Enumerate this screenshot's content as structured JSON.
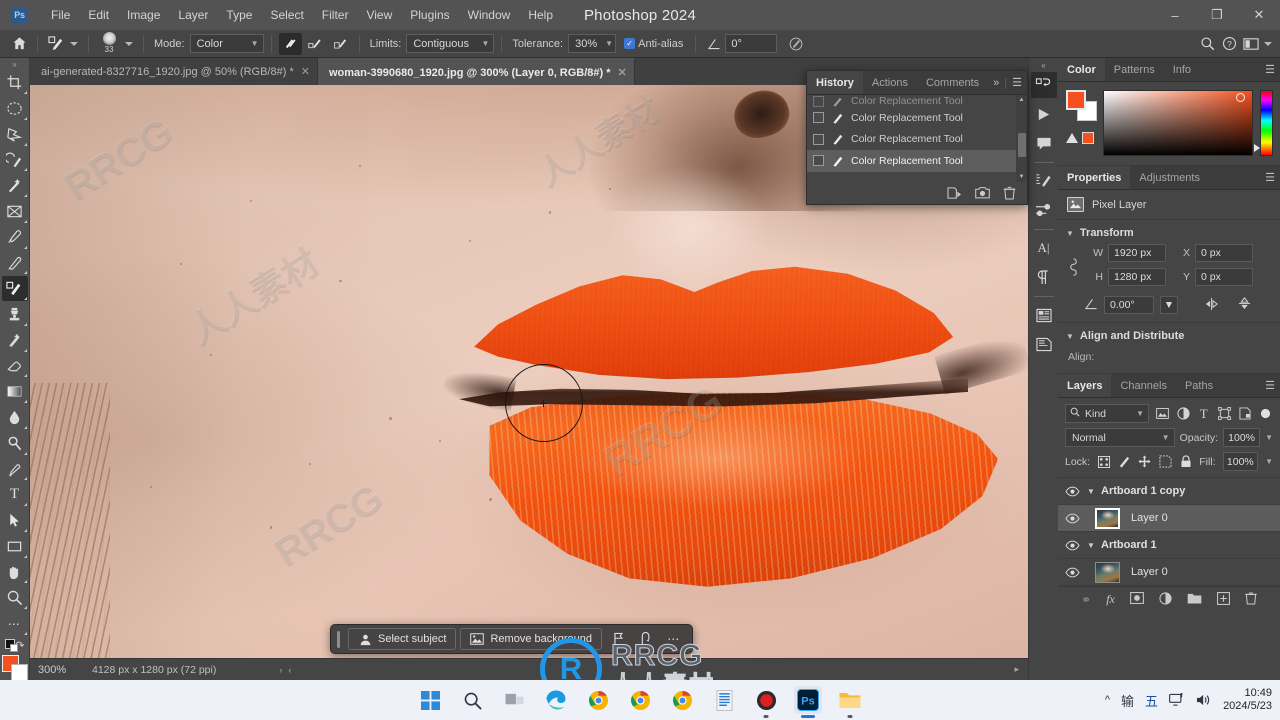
{
  "window": {
    "title": "Photoshop 2024",
    "app_logo": "ps-logo",
    "minimize": "–",
    "maximize": "❐",
    "close": "✕"
  },
  "menubar": {
    "items": [
      {
        "label": "File"
      },
      {
        "label": "Edit"
      },
      {
        "label": "Image"
      },
      {
        "label": "Layer"
      },
      {
        "label": "Type"
      },
      {
        "label": "Select"
      },
      {
        "label": "Filter"
      },
      {
        "label": "View"
      },
      {
        "label": "Plugins"
      },
      {
        "label": "Window"
      },
      {
        "label": "Help"
      }
    ]
  },
  "options_bar": {
    "home_icon": "home-icon",
    "tool_preset_icon": "color-replacement-tool-icon",
    "brush_size": "33",
    "mode_label": "Mode:",
    "mode_value": "Color",
    "sampling_continuous_icon": "sampling-continuous-icon",
    "sampling_once_icon": "sampling-once-icon",
    "sampling_background_icon": "sampling-background-swatch-icon",
    "limits_label": "Limits:",
    "limits_value": "Contiguous",
    "tolerance_label": "Tolerance:",
    "tolerance_value": "30%",
    "antialias_label": "Anti-alias",
    "antialias_checked": true,
    "angle_label": "angle-icon",
    "angle_value": "0°",
    "pressure_icon": "tablet-pressure-icon",
    "search_icon": "search-icon",
    "help_icon": "help-icon",
    "workspace_icon": "workspace-switcher-icon"
  },
  "toolbar": {
    "collapse_icon": "expand-toolbar-icon",
    "tools": [
      {
        "name": "crop-tool",
        "glyph": "⯨",
        "active": false
      },
      {
        "name": "elliptical-marquee-tool",
        "glyph": "◯",
        "active": false
      },
      {
        "name": "lasso-tool",
        "glyph": "⬠",
        "active": false
      },
      {
        "name": "object-selection-tool",
        "glyph": "⥁",
        "active": false
      },
      {
        "name": "quick-selection-tool",
        "glyph": "✒",
        "active": false
      },
      {
        "name": "frame-tool",
        "glyph": "⌧",
        "active": false
      },
      {
        "name": "eyedropper-tool",
        "glyph": "✐",
        "active": false
      },
      {
        "name": "healing-brush-tool",
        "glyph": "✎",
        "active": false
      },
      {
        "name": "color-replacement-tool",
        "glyph": "὘C",
        "active": true
      },
      {
        "name": "clone-stamp-tool",
        "glyph": "⚍",
        "active": false
      },
      {
        "name": "history-brush-tool",
        "glyph": "✐",
        "active": false
      },
      {
        "name": "eraser-tool",
        "glyph": "▱",
        "active": false
      },
      {
        "name": "gradient-tool",
        "glyph": "▤",
        "active": false
      },
      {
        "name": "blur-tool",
        "glyph": "Ὂ7",
        "active": false
      },
      {
        "name": "dodge-tool",
        "glyph": "⚲",
        "active": false
      },
      {
        "name": "pen-tool",
        "glyph": "✒",
        "active": false
      },
      {
        "name": "type-tool",
        "glyph": "T",
        "active": false
      },
      {
        "name": "path-selection-tool",
        "glyph": "➤",
        "active": false
      },
      {
        "name": "rectangle-tool",
        "glyph": "▭",
        "active": false
      },
      {
        "name": "hand-tool",
        "glyph": "✋",
        "active": false
      },
      {
        "name": "zoom-tool",
        "glyph": "⌕",
        "active": false
      },
      {
        "name": "edit-toolbar-more",
        "glyph": "⋯",
        "active": false
      }
    ],
    "foreground_color": "#f4511e",
    "background_color": "#ffffff",
    "swap_colors_icon": "swap-colors-icon",
    "default_colors_icon": "default-colors-icon"
  },
  "document_tabs": [
    {
      "label": "ai-generated-8327716_1920.jpg @ 50% (RGB/8#) *",
      "active": false,
      "close": "✕"
    },
    {
      "label": "woman-3990680_1920.jpg @ 300% (Layer 0, RGB/8#) *",
      "active": true,
      "close": "✕"
    }
  ],
  "canvas": {
    "watermarks": [
      "RRCG",
      "RRCG",
      "RRCG",
      "人人素材",
      "人人素材"
    ],
    "brush_cursor_name": "brush-cursor"
  },
  "contextual_task_bar": {
    "select_subject": "Select subject",
    "remove_background": "Remove background",
    "select_subject_icon": "person-icon",
    "remove_background_icon": "image-icon",
    "mask_icon": "mask-flag-icon",
    "transform_icon": "transform-icon",
    "more_icon": "more-options-icon",
    "grip_icon": "drag-handle-icon"
  },
  "status_bar": {
    "zoom": "300%",
    "doc_info": "4128 px x 1280 px (72 ppi)",
    "next_arrow": "›",
    "prev_arrow": "‹"
  },
  "right_rail": {
    "collapse_icon": "collapse-panels-icon",
    "icons": [
      {
        "name": "history-panel-icon",
        "glyph": "↺",
        "active": true
      },
      {
        "name": "actions-panel-icon",
        "glyph": "▶",
        "active": false
      },
      {
        "name": "comments-panel-icon",
        "glyph": "὞9",
        "active": false
      },
      {
        "name": "brush-settings-icon",
        "glyph": "✐",
        "active": false
      },
      {
        "name": "brushes-panel-icon",
        "glyph": "≡",
        "active": false
      },
      {
        "name": "character-panel-icon",
        "glyph": "A",
        "active": false
      },
      {
        "name": "paragraph-panel-icon",
        "glyph": "¶",
        "active": false
      },
      {
        "name": "libraries-panel-icon",
        "glyph": "▦",
        "active": false
      },
      {
        "name": "notes-panel-icon",
        "glyph": "▧",
        "active": false
      }
    ]
  },
  "history_panel": {
    "tabs": [
      {
        "label": "History",
        "active": true
      },
      {
        "label": "Actions",
        "active": false
      },
      {
        "label": "Comments",
        "active": false
      }
    ],
    "expand_icon": "»",
    "menu_icon": "☰",
    "items": [
      {
        "label": "Color Replacement Tool",
        "selected": false,
        "partial": true
      },
      {
        "label": "Color Replacement Tool",
        "selected": false
      },
      {
        "label": "Color Replacement Tool",
        "selected": false
      },
      {
        "label": "Color Replacement Tool",
        "selected": true
      }
    ],
    "footer": [
      {
        "name": "new-document-from-state-icon",
        "glyph": "❐"
      },
      {
        "name": "create-snapshot-icon",
        "glyph": "὏7"
      },
      {
        "name": "delete-state-icon",
        "glyph": "Ὕ1"
      }
    ],
    "scroll_up": "▲",
    "scroll_down": "▼"
  },
  "color_panel": {
    "tabs": [
      {
        "label": "Color",
        "active": true
      },
      {
        "label": "Patterns",
        "active": false
      },
      {
        "label": "Info",
        "active": false
      }
    ],
    "menu_icon": "☰",
    "foreground": "#f4511e",
    "background": "#ffffff",
    "out_of_gamut_swatch": "#f4511e",
    "warning_icon": "out-of-gamut-warning-icon"
  },
  "properties_panel": {
    "tabs": [
      {
        "label": "Properties",
        "active": true
      },
      {
        "label": "Adjustments",
        "active": false
      }
    ],
    "menu_icon": "☰",
    "layer_type": "Pixel Layer",
    "layer_type_icon": "pixel-layer-icon",
    "transform": {
      "title": "Transform",
      "link_icon": "link-width-height-icon",
      "w_label": "W",
      "w_value": "1920 px",
      "x_label": "X",
      "x_value": "0 px",
      "h_label": "H",
      "h_value": "1280 px",
      "y_label": "Y",
      "y_value": "0 px",
      "angle_icon": "rotation-angle-icon",
      "angle_value": "0.00°",
      "flip_horizontal_icon": "flip-horizontal-icon",
      "flip_vertical_icon": "flip-vertical-icon"
    },
    "align_distribute": {
      "title": "Align and Distribute",
      "align_label": "Align:"
    }
  },
  "layers_panel": {
    "tabs": [
      {
        "label": "Layers",
        "active": true
      },
      {
        "label": "Channels",
        "active": false
      },
      {
        "label": "Paths",
        "active": false
      }
    ],
    "menu_icon": "☰",
    "filter_label": "Kind",
    "filter_icon": "search-icon",
    "filter_types": [
      {
        "name": "filter-pixel-icon",
        "glyph": "ὛC"
      },
      {
        "name": "filter-adjustment-icon",
        "glyph": "◑"
      },
      {
        "name": "filter-type-icon",
        "glyph": "T"
      },
      {
        "name": "filter-shape-icon",
        "glyph": "⛶"
      },
      {
        "name": "filter-smart-object-icon",
        "glyph": "◰"
      },
      {
        "name": "filter-toggle-icon",
        "glyph": "●"
      }
    ],
    "blend_mode": "Normal",
    "opacity_label": "Opacity:",
    "opacity_value": "100%",
    "lock_label": "Lock:",
    "lock_icons": [
      {
        "name": "lock-transparency-icon",
        "glyph": "░"
      },
      {
        "name": "lock-image-pixels-icon",
        "glyph": "✐"
      },
      {
        "name": "lock-position-icon",
        "glyph": "✥"
      },
      {
        "name": "lock-artboard-nesting-icon",
        "glyph": "⌧"
      },
      {
        "name": "lock-all-icon",
        "glyph": "ὑ2"
      }
    ],
    "fill_label": "Fill:",
    "fill_value": "100%",
    "layers": [
      {
        "name": "Artboard 1 copy",
        "type": "group",
        "visible": true,
        "selected": false,
        "expanded": true
      },
      {
        "name": "Layer 0",
        "type": "pixel",
        "visible": true,
        "selected": true,
        "expanded": false
      },
      {
        "name": "Artboard 1",
        "type": "group",
        "visible": true,
        "selected": false,
        "expanded": true
      },
      {
        "name": "Layer 0",
        "type": "pixel",
        "visible": true,
        "selected": false,
        "expanded": false
      }
    ],
    "footer_icons": [
      {
        "name": "link-layers-icon",
        "glyph": "⚭"
      },
      {
        "name": "layer-style-icon",
        "glyph": "fx"
      },
      {
        "name": "add-layer-mask-icon",
        "glyph": "▣"
      },
      {
        "name": "new-fill-adjustment-icon",
        "glyph": "◑"
      },
      {
        "name": "new-group-icon",
        "glyph": "὜0"
      },
      {
        "name": "new-layer-icon",
        "glyph": "⊞"
      },
      {
        "name": "delete-layer-icon",
        "glyph": "Ὕ1"
      }
    ]
  },
  "taskbar": {
    "apps": [
      {
        "name": "start-button-icon",
        "active": false
      },
      {
        "name": "search-icon",
        "active": false
      },
      {
        "name": "task-view-icon",
        "active": false
      },
      {
        "name": "edge-icon",
        "active": false
      },
      {
        "name": "chrome-icon",
        "active": false
      },
      {
        "name": "chrome-icon",
        "active": false
      },
      {
        "name": "chrome-icon",
        "active": false
      },
      {
        "name": "text-editor-icon",
        "active": false
      },
      {
        "name": "recorder-icon",
        "active": false
      },
      {
        "name": "photoshop-icon",
        "active": true
      },
      {
        "name": "file-explorer-icon",
        "active": false
      }
    ],
    "tray": [
      {
        "name": "show-hidden-icons-icon",
        "glyph": "⌃"
      },
      {
        "name": "ime-tray-icon",
        "glyph": "輸"
      },
      {
        "name": "ime-chinese-icon",
        "glyph": "五"
      },
      {
        "name": "network-icon",
        "glyph": "὚7"
      },
      {
        "name": "volume-icon",
        "glyph": "ὐA"
      }
    ],
    "clock_time": "10:49",
    "clock_date": "2024/5/23"
  },
  "overlay_watermark": {
    "badge": "R",
    "english": "RRCG",
    "chinese": "人人素材"
  }
}
